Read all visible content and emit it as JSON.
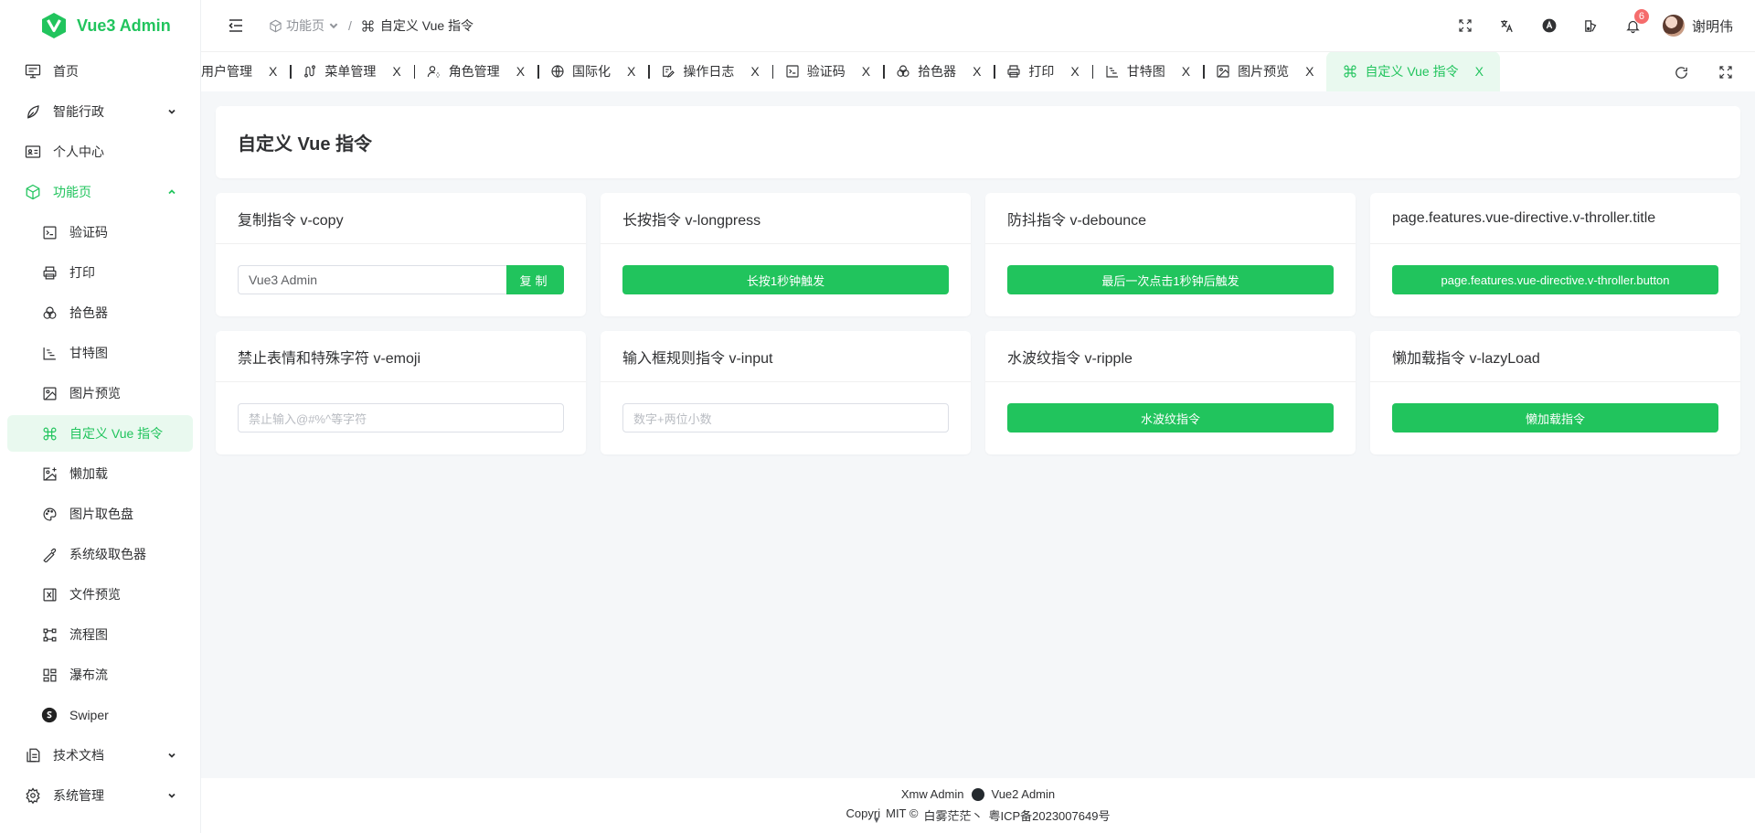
{
  "app": {
    "title": "Vue3 Admin",
    "accent": "#21c45d"
  },
  "sidebar": {
    "items": [
      {
        "label": "首页",
        "icon": "monitor-icon"
      },
      {
        "label": "智能行政",
        "icon": "leaf-icon"
      },
      {
        "label": "个人中心",
        "icon": "idcard-icon"
      },
      {
        "label": "功能页",
        "icon": "box-icon"
      },
      {
        "label": "验证码",
        "icon": "terminal-icon"
      },
      {
        "label": "打印",
        "icon": "printer-icon"
      },
      {
        "label": "拾色器",
        "icon": "circles-icon"
      },
      {
        "label": "甘特图",
        "icon": "gantt-icon"
      },
      {
        "label": "图片预览",
        "icon": "image-icon"
      },
      {
        "label": "自定义 Vue 指令",
        "icon": "command-icon"
      },
      {
        "label": "懒加载",
        "icon": "image-plus-icon"
      },
      {
        "label": "图片取色盘",
        "icon": "palette-icon"
      },
      {
        "label": "系统级取色器",
        "icon": "pipette-icon"
      },
      {
        "label": "文件预览",
        "icon": "file-x-icon"
      },
      {
        "label": "流程图",
        "icon": "flow-icon"
      },
      {
        "label": "瀑布流",
        "icon": "grid-icon"
      },
      {
        "label": "Swiper",
        "icon": "swiper-icon"
      },
      {
        "label": "技术文档",
        "icon": "docs-icon"
      },
      {
        "label": "系统管理",
        "icon": "gear-icon"
      }
    ]
  },
  "header": {
    "breadcrumb": [
      {
        "label": "功能页"
      },
      {
        "label": "自定义 Vue 指令"
      }
    ],
    "breadcrumb_sep": "/",
    "notification_count": "6",
    "user_name": "谢明伟"
  },
  "tabs": [
    {
      "label": "用户管理",
      "icon": ""
    },
    {
      "label": "菜单管理",
      "icon": "route-icon"
    },
    {
      "label": "角色管理",
      "icon": "user-cog-icon"
    },
    {
      "label": "国际化",
      "icon": "globe-icon"
    },
    {
      "label": "操作日志",
      "icon": "edit-icon"
    },
    {
      "label": "验证码",
      "icon": "terminal-icon"
    },
    {
      "label": "拾色器",
      "icon": "circles-icon"
    },
    {
      "label": "打印",
      "icon": "printer-icon"
    },
    {
      "label": "甘特图",
      "icon": "gantt-icon"
    },
    {
      "label": "图片预览",
      "icon": "image-icon"
    },
    {
      "label": "自定义 Vue 指令",
      "icon": "command-icon"
    }
  ],
  "tab_close": "X",
  "page": {
    "title": "自定义 Vue 指令"
  },
  "cards": {
    "copy": {
      "title": "复制指令 v-copy",
      "input_value": "Vue3 Admin",
      "button": "复制"
    },
    "longpress": {
      "title": "长按指令 v-longpress",
      "button": "长按1秒钟触发"
    },
    "debounce": {
      "title": "防抖指令 v-debounce",
      "button": "最后一次点击1秒钟后触发"
    },
    "throttle": {
      "title": "page.features.vue-directive.v-throller.title",
      "button": "page.features.vue-directive.v-throller.button"
    },
    "emoji": {
      "title": "禁止表情和特殊字符 v-emoji",
      "placeholder": "禁止输入@#%^等字符"
    },
    "input": {
      "title": "输入框规则指令 v-input",
      "placeholder": "数字+两位小数"
    },
    "ripple": {
      "title": "水波纹指令 v-ripple",
      "button": "水波纹指令"
    },
    "lazyload": {
      "title": "懒加载指令 v-lazyLoad",
      "button": "懒加载指令"
    }
  },
  "footer": {
    "line1_left": "Xmw Admin",
    "line1_right": "Vue2 Admin",
    "line2_copyright": "Copyri",
    "line2_license": "MIT ©",
    "line2_author": "白雾茫茫丶",
    "line2_icp": "粤ICP备2023007649号"
  }
}
